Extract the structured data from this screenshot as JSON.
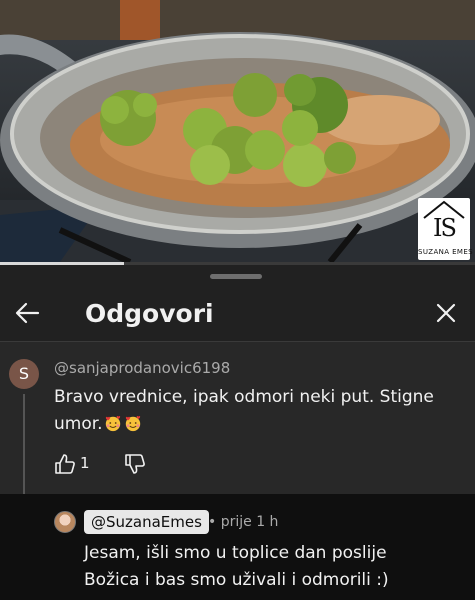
{
  "video": {
    "progress_fraction": 0.26,
    "watermark": {
      "monogram": "IS",
      "text": "SUZANA EMES"
    }
  },
  "panel": {
    "title": "Odgovori",
    "back_icon": "arrow-left-icon",
    "close_icon": "close-icon"
  },
  "parent_comment": {
    "avatar_letter": "S",
    "avatar_color": "#795548",
    "author": "@sanjaprodanovic6198",
    "text_line1": "Bravo vrednice, ipak odmori neki put. Stigne",
    "text_line2": "umor.",
    "emojis": [
      "smiling-face-with-hearts-icon",
      "smiling-face-with-hearts-icon"
    ],
    "like_count": "1"
  },
  "reply": {
    "author": "@SuzanaEmes",
    "time": "• prije 1 h",
    "text_line1": "Jesam, išli smo u toplice dan poslije",
    "text_line2": "Božica i bas smo uživali i odmorili :)"
  }
}
